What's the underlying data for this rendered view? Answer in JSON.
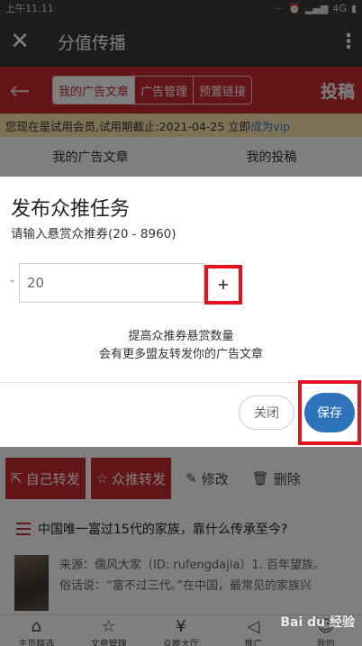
{
  "status_bar": {
    "time": "上午11:11",
    "dots": "···",
    "network": "4G"
  },
  "title_bar": {
    "title": "分值传播",
    "close_icon": "close-icon",
    "more_icon": "more-vertical-icon"
  },
  "header": {
    "back_icon": "back-arrow-icon",
    "tabs": [
      "我的广告文章",
      "广告管理",
      "预置链接"
    ],
    "active_tab": 0,
    "post_label": "投稿",
    "accent_color": "#c72a30"
  },
  "trial_notice": {
    "text": "您现在是试用会员,试用期截止:2021-04-25 立即",
    "link": "成为vip"
  },
  "sub_tabs": [
    "我的广告文章",
    "我的投稿"
  ],
  "actions": {
    "self_share": "自己转发",
    "crowd_share": "众推转发",
    "edit": "修改",
    "delete": "删除"
  },
  "article": {
    "headline": "中国唯一富过15代的家族，靠什么传承至今?",
    "line1": "来源：儒风大家（ID: rufengdajia）1. 百年望族。",
    "line2": "俗话说：“富不过三代。”在中国，最常见的家族兴"
  },
  "bottom_nav": [
    "主页精选",
    "文章管理",
    "众推大厅",
    "推广",
    "我的"
  ],
  "dialog": {
    "title": "发布众推任务",
    "subtitle": "请输入悬赏众推券(20 - 8960)",
    "minus": "-",
    "value": "20",
    "plus": "+",
    "hint_line1": "提高众推券悬赏数量",
    "hint_line2": "会有更多盟友转发你的广告文章",
    "close_label": "关闭",
    "save_label": "保存",
    "save_color": "#2d74bc"
  },
  "watermark": "Bai du 经验"
}
